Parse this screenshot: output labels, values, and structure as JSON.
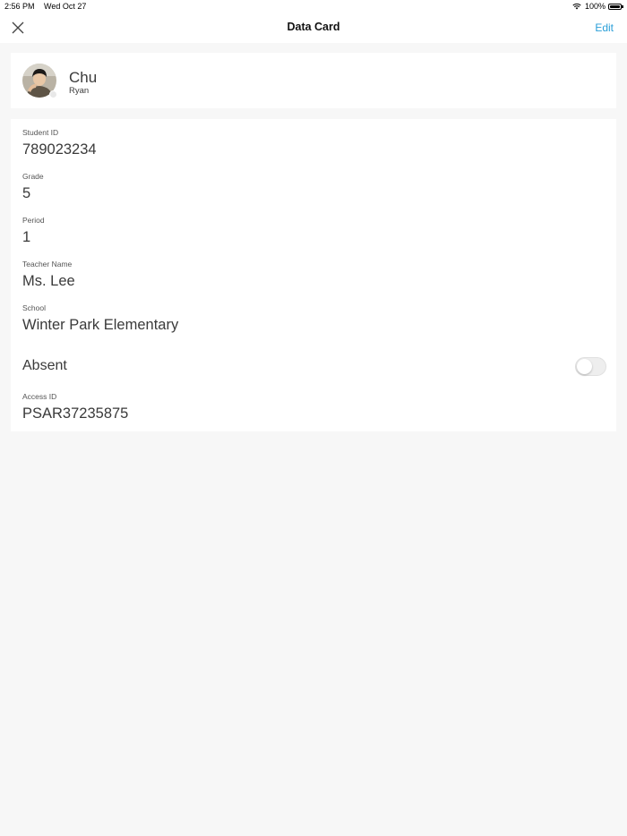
{
  "status_bar": {
    "time": "2:56 PM",
    "date": "Wed Oct 27",
    "battery": "100%",
    "icons": [
      "wifi-icon",
      "battery-icon"
    ]
  },
  "nav": {
    "title": "Data Card",
    "edit_label": "Edit",
    "close_icon": "close-icon",
    "accent_color": "#2a9fd8"
  },
  "profile": {
    "last_name": "Chu",
    "first_name": "Ryan",
    "avatar": "student-photo"
  },
  "fields": [
    {
      "label": "Student ID",
      "value": "789023234"
    },
    {
      "label": "Grade",
      "value": "5"
    },
    {
      "label": "Period",
      "value": "1"
    },
    {
      "label": "Teacher Name",
      "value": "Ms. Lee"
    },
    {
      "label": "School",
      "value": "Winter Park Elementary"
    }
  ],
  "absent": {
    "label": "Absent",
    "on": false
  },
  "access": {
    "label": "Access ID",
    "value": "PSAR37235875"
  }
}
